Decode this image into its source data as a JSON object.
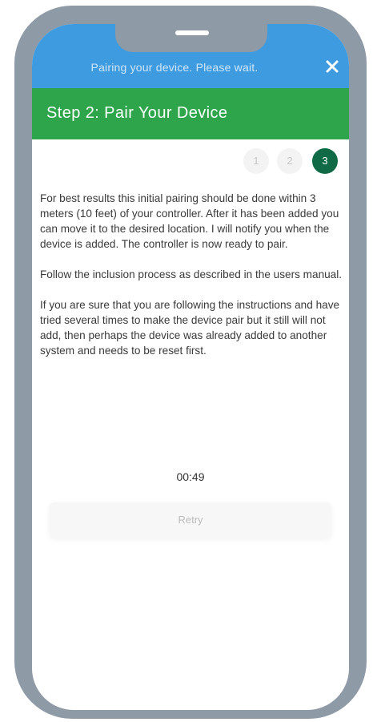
{
  "status": {
    "message": "Pairing your device. Please wait."
  },
  "header": {
    "title": "Step 2: Pair Your Device"
  },
  "steps": [
    {
      "label": "1",
      "active": false
    },
    {
      "label": "2",
      "active": false
    },
    {
      "label": "3",
      "active": true
    }
  ],
  "content": {
    "paragraphs": [
      "For best results this initial pairing should be done within 3 meters (10 feet) of your controller. After it has been added you can move it to the desired location.  I will notify you when the device is added. The controller is now ready to pair.",
      "Follow the inclusion process as described in the users manual.",
      "If you are sure that you are following the instructions and have tried several times to make the device pair but it still will not add, then perhaps the device was already added to another system and needs to be reset first."
    ]
  },
  "timer": "00:49",
  "retry_label": "Retry",
  "colors": {
    "status_bar": "#3f9be0",
    "header": "#2ea54a",
    "active_step": "#0f6a45",
    "phone_frame": "#8e9aa6"
  },
  "icons": {
    "close": "close-icon"
  }
}
